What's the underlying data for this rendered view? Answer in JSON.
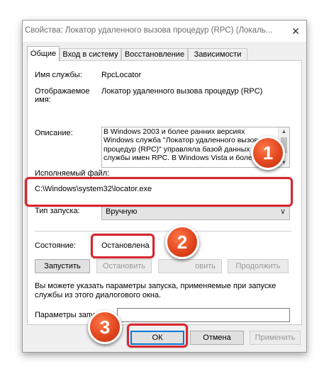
{
  "window": {
    "title": "Свойства: Локатор удаленного вызова процедур (RPC) (Локаль...",
    "close_glyph": "✕"
  },
  "tabs": [
    {
      "label": "Общие",
      "active": true
    },
    {
      "label": "Вход в систему",
      "active": false
    },
    {
      "label": "Восстановление",
      "active": false
    },
    {
      "label": "Зависимости",
      "active": false
    }
  ],
  "general": {
    "service_name_label": "Имя службы:",
    "service_name_value": "RpcLocator",
    "display_name_label_line1": "Отображаемое",
    "display_name_label_line2": "имя:",
    "display_name_value": "Локатор удаленного вызова процедур (RPC)",
    "description_label": "Описание:",
    "description_lines": [
      "В Windows 2003 и более ранних версиях",
      "Windows служба \"Локатор удаленного вызова",
      "процедур (RPC)\" управляла базой данных",
      "службы имен RPC. В Windows Vista и более"
    ],
    "exe_label": "Исполняемый файл:",
    "exe_path": "C:\\Windows\\system32\\locator.exe",
    "startup_type_label": "Тип запуска:",
    "startup_type_value": "Вручную",
    "status_label": "Состояние:",
    "status_value": "Остановлена",
    "buttons": {
      "start": "Запустить",
      "stop": "Остановить",
      "pause": "Приостановить",
      "pause_visible": "овить",
      "resume": "Продолжить"
    },
    "hint_line1": "Вы можете указать параметры запуска, применяемые при запуске",
    "hint_line2": "службы из этого диалогового окна.",
    "params_label": "Параметры запуска:",
    "params_value": ""
  },
  "footer": {
    "ok": "ОК",
    "cancel": "Отмена",
    "apply": "Применить"
  },
  "annotations": {
    "markers": [
      "1",
      "2",
      "3"
    ],
    "highlight_color": "#d9252e",
    "marker_color": "#e2461e"
  }
}
